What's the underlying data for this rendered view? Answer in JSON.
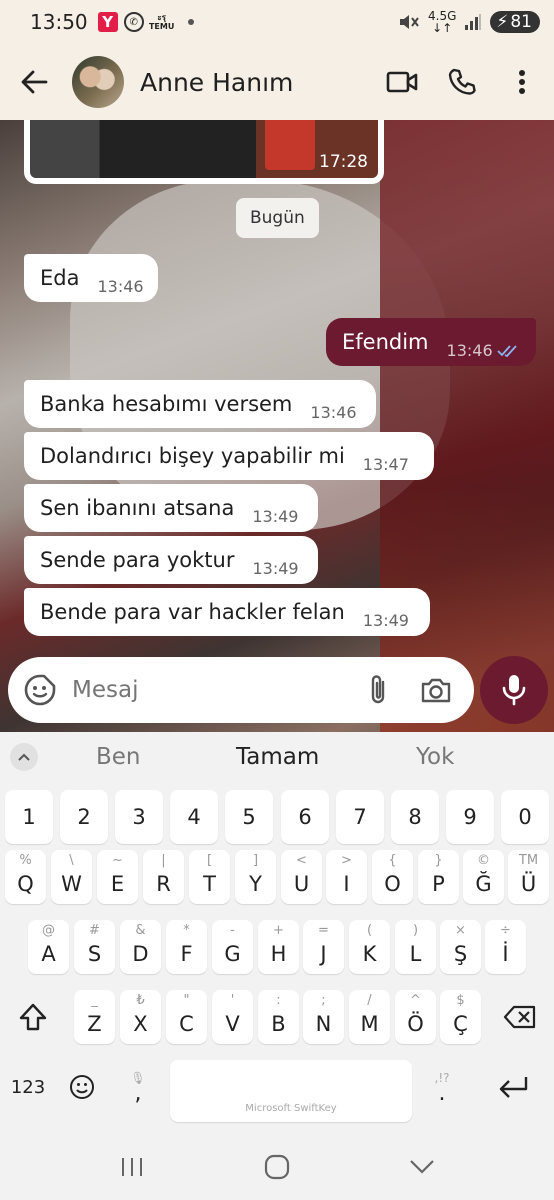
{
  "status": {
    "time": "13:50",
    "app_y": "Y",
    "temu_top": "ะรุ",
    "temu_bottom": "TEMU",
    "net_top": "4.5G",
    "net_bottom": "↓↑",
    "battery": "81"
  },
  "header": {
    "contact_name": "Anne Hanım",
    "icons": [
      "back-arrow-icon",
      "video-call-icon",
      "phone-icon",
      "more-vert-icon"
    ]
  },
  "chat": {
    "prev_time": "17:28",
    "day_label": "Bugün",
    "messages": [
      {
        "dir": "in",
        "text": "Eda",
        "time": "13:46"
      },
      {
        "dir": "out",
        "text": "Efendim",
        "time": "13:46"
      },
      {
        "dir": "in",
        "text": "Banka hesabımı versem",
        "time": "13:46"
      },
      {
        "dir": "in",
        "text": "Dolandırıcı bişey yapabilir mi",
        "time": "13:47"
      },
      {
        "dir": "in",
        "text": "Sen ibanını atsana",
        "time": "13:49"
      },
      {
        "dir": "in",
        "text": "Sende para yoktur",
        "time": "13:49"
      },
      {
        "dir": "in",
        "text": "Bende para var hackler felan",
        "time": "13:49"
      }
    ]
  },
  "input": {
    "placeholder": "Mesaj"
  },
  "keyboard": {
    "suggestions": [
      "Ben",
      "Tamam",
      "Yok"
    ],
    "numbers": [
      "1",
      "2",
      "3",
      "4",
      "5",
      "6",
      "7",
      "8",
      "9",
      "0"
    ],
    "row1": [
      {
        "k": "Q",
        "s": "%"
      },
      {
        "k": "W",
        "s": "\\"
      },
      {
        "k": "E",
        "s": "~"
      },
      {
        "k": "R",
        "s": "|"
      },
      {
        "k": "T",
        "s": "["
      },
      {
        "k": "Y",
        "s": "]"
      },
      {
        "k": "U",
        "s": "<"
      },
      {
        "k": "I",
        "s": ">"
      },
      {
        "k": "O",
        "s": "{"
      },
      {
        "k": "P",
        "s": "}"
      },
      {
        "k": "Ğ",
        "s": "©"
      },
      {
        "k": "Ü",
        "s": "TM"
      }
    ],
    "row2": [
      {
        "k": "A",
        "s": "@"
      },
      {
        "k": "S",
        "s": "#"
      },
      {
        "k": "D",
        "s": "&"
      },
      {
        "k": "F",
        "s": "*"
      },
      {
        "k": "G",
        "s": "-"
      },
      {
        "k": "H",
        "s": "+"
      },
      {
        "k": "J",
        "s": "="
      },
      {
        "k": "K",
        "s": "("
      },
      {
        "k": "L",
        "s": ")"
      },
      {
        "k": "Ş",
        "s": "×"
      },
      {
        "k": "İ",
        "s": "÷"
      }
    ],
    "row3": [
      {
        "k": "Z",
        "s": "_"
      },
      {
        "k": "X",
        "s": "₺"
      },
      {
        "k": "C",
        "s": "\""
      },
      {
        "k": "V",
        "s": "'"
      },
      {
        "k": "B",
        "s": ":"
      },
      {
        "k": "N",
        "s": ";"
      },
      {
        "k": "M",
        "s": "/"
      },
      {
        "k": "Ö",
        "s": "^"
      },
      {
        "k": "Ç",
        "s": "$"
      }
    ],
    "mode_label": "123",
    "comma": ",",
    "comma_sub": "🎙",
    "space_brand": "Microsoft SwiftKey",
    "period": ".",
    "period_sub": ",!?"
  },
  "colors": {
    "accent": "#6c1a2f",
    "header_bg": "#f5efe6",
    "keyboard_bg": "#f2f2f2"
  }
}
